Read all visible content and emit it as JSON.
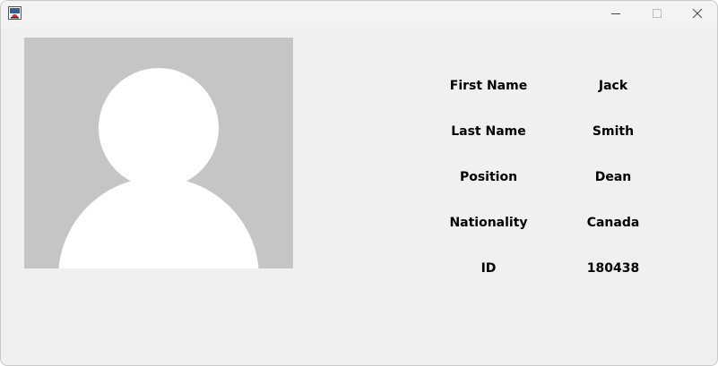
{
  "profile": {
    "fields": [
      {
        "label": "First Name",
        "value": "Jack"
      },
      {
        "label": "Last Name",
        "value": "Smith"
      },
      {
        "label": "Position",
        "value": "Dean"
      },
      {
        "label": "Nationality",
        "value": "Canada"
      },
      {
        "label": "ID",
        "value": "180438"
      }
    ]
  },
  "icons": {
    "app": "java-app-icon",
    "minimize": "minimize-icon",
    "maximize": "maximize-icon",
    "close": "close-icon",
    "avatar": "person-silhouette-icon"
  },
  "colors": {
    "window_bg": "#f0f0f0",
    "photo_bg": "#c5c5c5",
    "avatar_fill": "#ffffff"
  }
}
